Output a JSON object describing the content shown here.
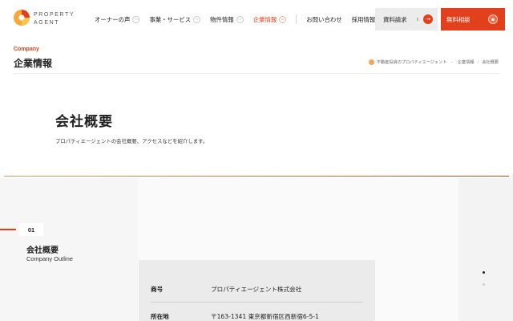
{
  "header": {
    "logo_line1": "PROPERTY",
    "logo_line2": "AGENT",
    "nav": [
      {
        "label": "オーナーの声",
        "has_menu": true,
        "active": false
      },
      {
        "label": "事業・サービス",
        "has_menu": true,
        "active": false
      },
      {
        "label": "物件情報",
        "has_menu": true,
        "active": false
      },
      {
        "label": "企業情報",
        "has_menu": true,
        "active": true
      }
    ],
    "nav_links": [
      {
        "label": "お問い合わせ"
      },
      {
        "label": "採用情報",
        "external": true
      }
    ],
    "doc_button_label": "資料請求",
    "consult_button_label": "無料相談",
    "accent_color": "#e2401c"
  },
  "page": {
    "eyebrow": "Company",
    "title": "企業情報",
    "breadcrumb": [
      "不動産投資のプロパティエージェント",
      "企業情報",
      "会社概要"
    ]
  },
  "intro": {
    "title": "会社概要",
    "text": "プロパティエージェントの会社概要、アクセスなどを紹介します。"
  },
  "outline": {
    "number": "01",
    "title": "会社概要",
    "subtitle": "Company Outline",
    "rows": [
      {
        "label": "商号",
        "value": "プロパティエージェント株式会社"
      },
      {
        "label": "所在地",
        "value": "〒163-1341 東京都新宿区西新宿6-5-1"
      }
    ]
  },
  "icons": {
    "nav_chevron": "chevron-down-icon",
    "doc_arrow": "arrow-right-icon",
    "consult": "chat-icon",
    "breadcrumb_home": "home-icon"
  }
}
